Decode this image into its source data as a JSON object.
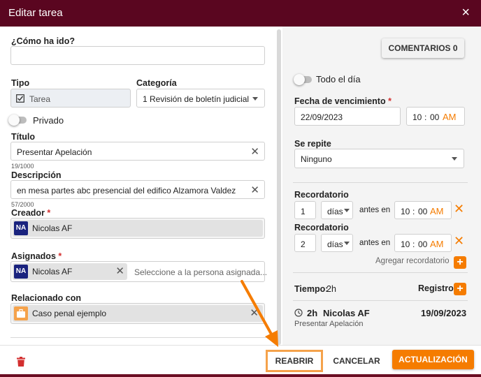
{
  "dialog": {
    "title": "Editar tarea",
    "close_icon": "×"
  },
  "left": {
    "how_label": "¿Cómo ha ido?",
    "how_value": "",
    "tipo_label": "Tipo",
    "tipo_value": "Tarea",
    "categoria_label": "Categoría",
    "categoria_value": "1 Revisión de boletín judicial",
    "privado_label": "Privado",
    "titulo_label": "Título",
    "titulo_value": "Presentar Apelación",
    "titulo_counter": "19/1000",
    "descripcion_label": "Descripción",
    "descripcion_value": "en mesa partes abc presencial del edifico Alzamora Valdez",
    "descripcion_counter": "57/2000",
    "creador_label": "Creador",
    "creador_avatar": "NA",
    "creador_value": "Nicolas AF",
    "asignados_label": "Asignados",
    "asignados_avatar": "NA",
    "asignados_value": "Nicolas AF",
    "asignados_placeholder": "Seleccione a la persona asignada...",
    "relacionado_label": "Relacionado con",
    "relacionado_value": "Caso penal ejemplo",
    "required_mark": "*"
  },
  "right": {
    "comentarios_button": "COMENTARIOS 0",
    "todo_dia_label": "Todo el día",
    "fecha_label": "Fecha de vencimiento",
    "fecha_value": "22/09/2023",
    "hora": "10",
    "minuto": "00",
    "ampm": "AM",
    "time_sep": ":",
    "repite_label": "Se repite",
    "repite_value": "Ninguno",
    "recordatorios": [
      {
        "label": "Recordatorio",
        "amount": "1",
        "unit": "días",
        "before": "antes en",
        "hour": "10",
        "minute": "00",
        "ampm": "AM"
      },
      {
        "label": "Recordatorio",
        "amount": "2",
        "unit": "días",
        "before": "antes en",
        "hour": "10",
        "minute": "00",
        "ampm": "AM"
      }
    ],
    "agregar_recordatorio": "Agregar recordatorio",
    "tiempo_label": "Tiempo:",
    "tiempo_value": "2h",
    "registro_label": "Registro",
    "log_duration": "2h",
    "log_user": "Nicolas AF",
    "log_date": "19/09/2023",
    "log_title": "Presentar Apelación"
  },
  "footer": {
    "reabrir": "REABRIR",
    "cancelar": "CANCELAR",
    "actualizar": "ACTUALIZACIÓN"
  },
  "colors": {
    "header": "#5a0620",
    "accent": "#f57c00",
    "highlight": "#f5a24b"
  }
}
